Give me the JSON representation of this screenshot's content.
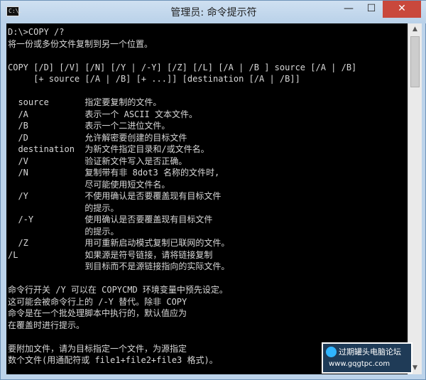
{
  "window": {
    "title": "管理员: 命令提示符",
    "icon_text": "C:\\.",
    "controls": {
      "minimize": "—",
      "maximize": "☐",
      "close": "✕"
    }
  },
  "terminal": {
    "lines": [
      "D:\\>COPY /?",
      "将一份或多份文件复制到另一个位置。",
      "",
      "COPY [/D] [/V] [/N] [/Y | /-Y] [/Z] [/L] [/A | /B ] source [/A | /B]",
      "     [+ source [/A | /B] [+ ...]] [destination [/A | /B]]",
      "",
      "  source       指定要复制的文件。",
      "  /A           表示一个 ASCII 文本文件。",
      "  /B           表示一个二进位文件。",
      "  /D           允许解密要创建的目标文件",
      "  destination  为新文件指定目录和/或文件名。",
      "  /V           验证新文件写入是否正确。",
      "  /N           复制带有非 8dot3 名称的文件时,",
      "               尽可能使用短文件名。",
      "  /Y           不使用确认是否要覆盖现有目标文件",
      "               的提示。",
      "  /-Y          使用确认是否要覆盖现有目标文件",
      "               的提示。",
      "  /Z           用可重新启动模式复制已联网的文件。",
      "/L             如果源是符号链接，请将链接复制",
      "               到目标而不是源链接指向的实际文件。",
      "",
      "命令行开关 /Y 可以在 COPYCMD 环境变量中预先设定。",
      "这可能会被命令行上的 /-Y 替代。除非 COPY",
      "命令是在一个批处理脚本中执行的，默认值应为",
      "在覆盖时进行提示。",
      "",
      "要附加文件，请为目标指定一个文件，为源指定",
      "数个文件(用通配符或 file1+file2+file3 格式)。"
    ]
  },
  "scrollbar": {
    "up_arrow": "▲",
    "down_arrow": "▼"
  },
  "watermark": {
    "title": "过期罐头电脑论坛",
    "url": "www.gqgtpc.com"
  }
}
